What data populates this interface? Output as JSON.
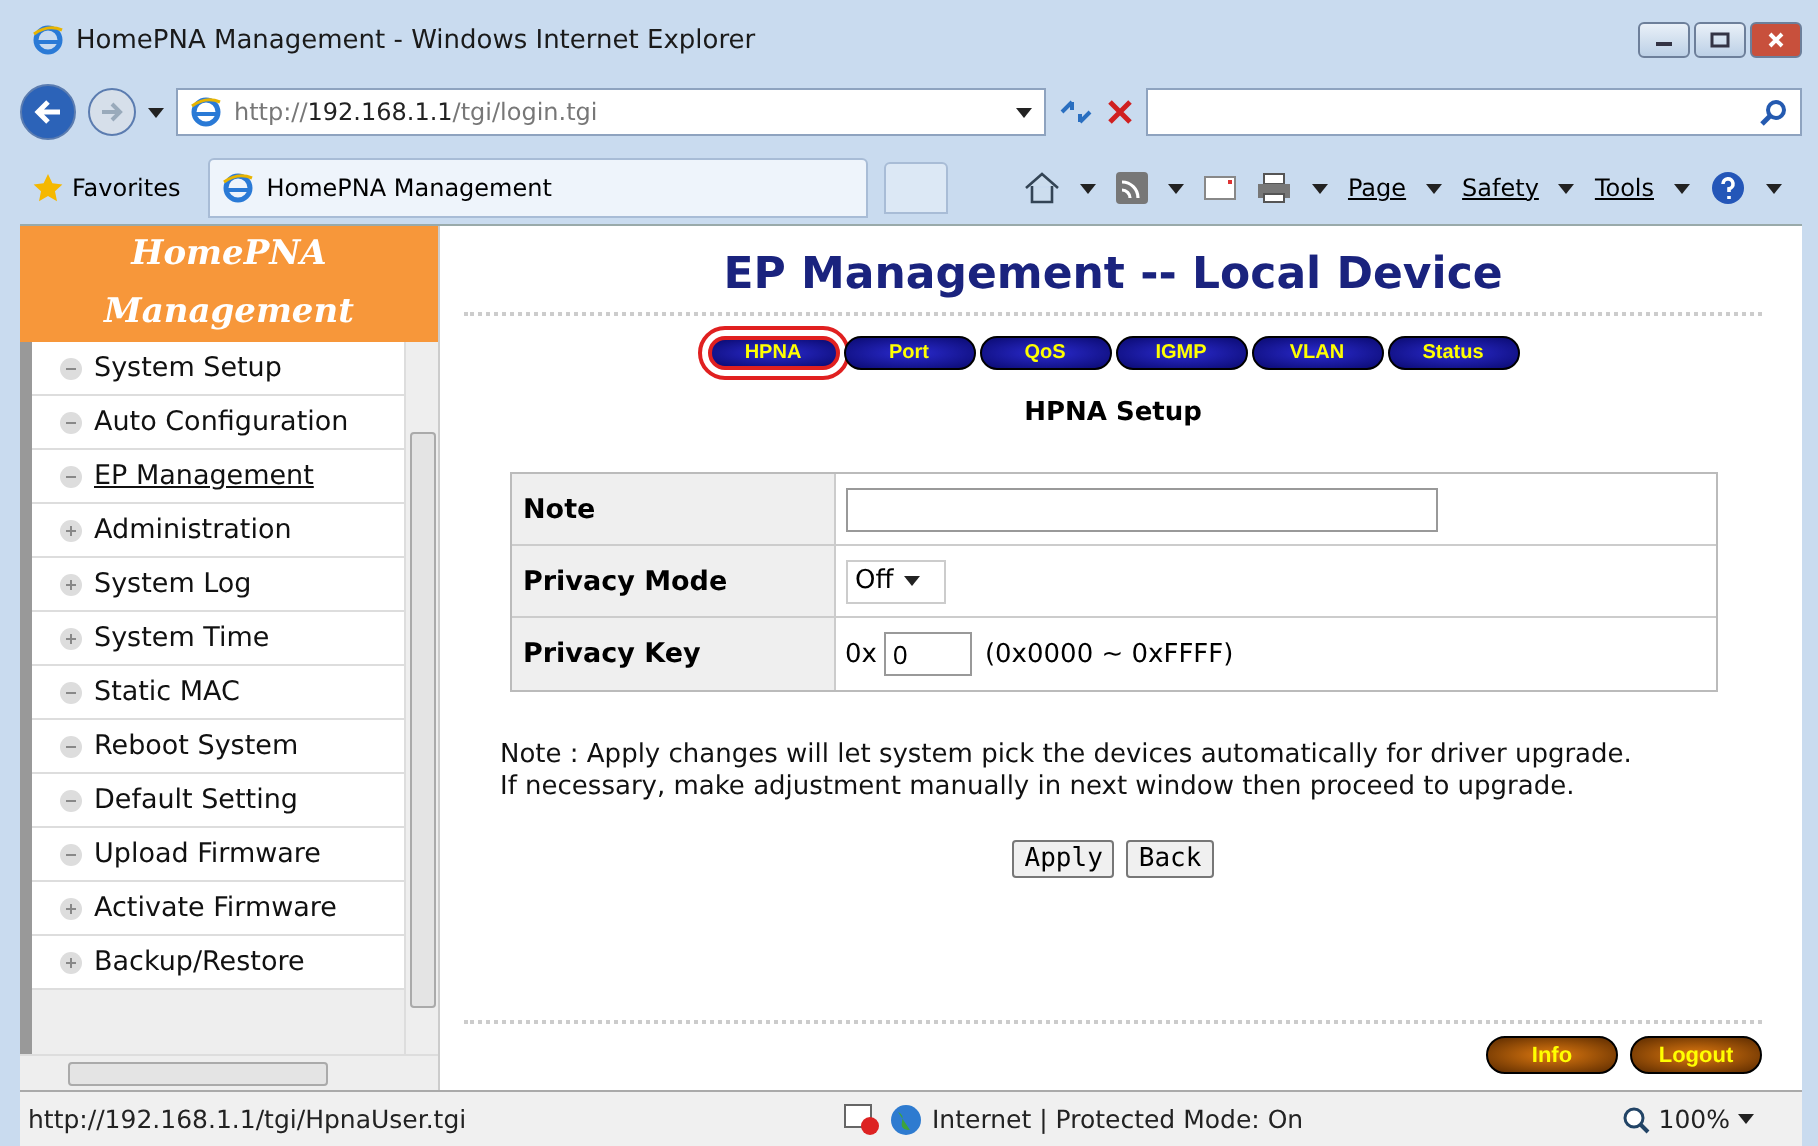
{
  "window": {
    "title": "HomePNA Management - Windows Internet Explorer"
  },
  "address": {
    "url_prefix": "http://",
    "url_host": "192.168.1.1",
    "url_path": "/tgi/login.tgi"
  },
  "toolbar": {
    "favorites": "Favorites",
    "tab": "HomePNA Management",
    "menus": [
      "Page",
      "Safety",
      "Tools"
    ]
  },
  "sidebar": {
    "title": "HomePNA Management",
    "items": [
      {
        "label": "System Setup",
        "kind": "minus",
        "selected": false
      },
      {
        "label": "Auto Configuration",
        "kind": "minus",
        "selected": false
      },
      {
        "label": "EP Management",
        "kind": "minus",
        "selected": true
      },
      {
        "label": "Administration",
        "kind": "plus",
        "selected": false
      },
      {
        "label": "System Log",
        "kind": "plus",
        "selected": false
      },
      {
        "label": "System Time",
        "kind": "plus",
        "selected": false
      },
      {
        "label": "Static MAC",
        "kind": "minus",
        "selected": false
      },
      {
        "label": "Reboot System",
        "kind": "minus",
        "selected": false
      },
      {
        "label": "Default Setting",
        "kind": "minus",
        "selected": false
      },
      {
        "label": "Upload Firmware",
        "kind": "minus",
        "selected": false
      },
      {
        "label": "Activate Firmware",
        "kind": "plus",
        "selected": false
      },
      {
        "label": "Backup/Restore",
        "kind": "plus",
        "selected": false
      }
    ]
  },
  "main": {
    "heading": "EP Management -- Local Device",
    "tabs": [
      {
        "label": "HPNA",
        "selected": true
      },
      {
        "label": "Port",
        "selected": false
      },
      {
        "label": "QoS",
        "selected": false
      },
      {
        "label": "IGMP",
        "selected": false
      },
      {
        "label": "VLAN",
        "selected": false
      },
      {
        "label": "Status",
        "selected": false
      }
    ],
    "section": "HPNA Setup",
    "form": [
      {
        "label": "Note",
        "kind": "text"
      },
      {
        "label": "Privacy Mode",
        "kind": "select",
        "value": "Off"
      },
      {
        "label": "Privacy Key",
        "kind": "key",
        "prefix": "0x",
        "value": "0",
        "hint": "(0x0000 ~ 0xFFFF)"
      }
    ],
    "note": [
      "Note : Apply changes will let system pick the devices automatically for driver upgrade.",
      "If necessary, make adjustment manually in next window then proceed to upgrade."
    ],
    "buttons": [
      "Apply",
      "Back"
    ],
    "footer_buttons": [
      "Info",
      "Logout"
    ]
  },
  "status_bar": {
    "url": "http://192.168.1.1/tgi/HpnaUser.tgi",
    "zone": "Internet | Protected Mode: On",
    "zoom": "100%"
  }
}
